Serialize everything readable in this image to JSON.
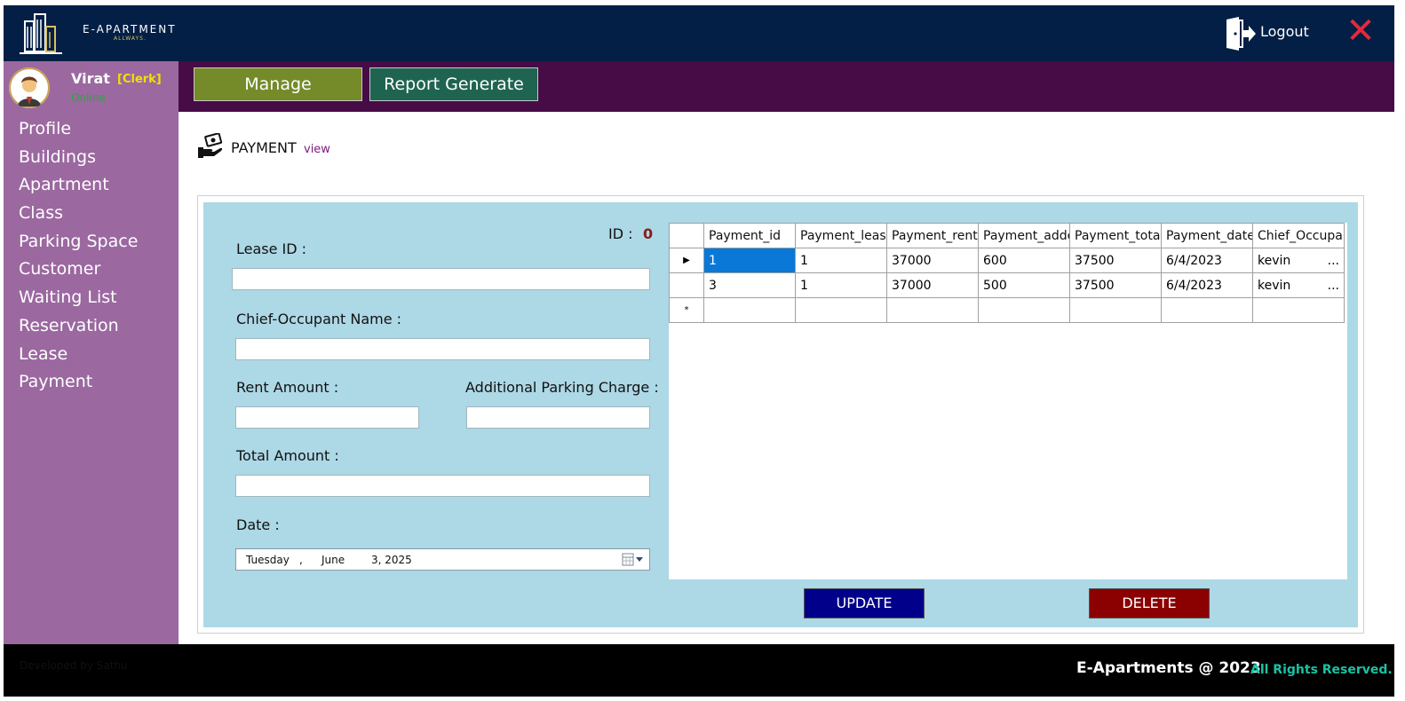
{
  "header": {
    "brand": "E-APARTMENT",
    "brand_sub": "ALLWAYS.",
    "logout_label": "Logout"
  },
  "user": {
    "name": "Virat",
    "role": "[Clerk]",
    "status": "Online"
  },
  "tabs": [
    {
      "label": "Manage",
      "color": "#758b2a"
    },
    {
      "label": "Report Generate",
      "color": "#1f6450"
    }
  ],
  "sidebar": {
    "items": [
      {
        "label": "Profile"
      },
      {
        "label": "Buildings"
      },
      {
        "label": "Apartment"
      },
      {
        "label": "Class"
      },
      {
        "label": "Parking Space"
      },
      {
        "label": "Customer"
      },
      {
        "label": "Waiting List"
      },
      {
        "label": "Reservation"
      },
      {
        "label": "Lease"
      },
      {
        "label": "Payment"
      }
    ]
  },
  "page": {
    "title": "PAYMENT",
    "subtitle": "view"
  },
  "form": {
    "id_label": "ID :",
    "id_value": "0",
    "lease_id_label": "Lease ID :",
    "lease_id_value": "",
    "chief_label": "Chief-Occupant Name :",
    "chief_value": "",
    "rent_label": "Rent Amount :",
    "rent_value": "",
    "parking_label": "Additional Parking Charge :",
    "parking_value": "",
    "total_label": "Total Amount :",
    "total_value": "",
    "date_label": "Date :",
    "date_day": "Tuesday",
    "date_sep": ",",
    "date_month": "June",
    "date_rest": "3, 2025"
  },
  "grid": {
    "columns": [
      "Payment_id",
      "Payment_lease",
      "Payment_rentA",
      "Payment_adde",
      "Payment_total",
      "Payment_date",
      "Chief_Occupar"
    ],
    "rows": [
      {
        "marker": "▶",
        "cells": [
          "1",
          "1",
          "37000",
          "600",
          "37500",
          "6/4/2023",
          "kevin"
        ],
        "selected": true
      },
      {
        "marker": "",
        "cells": [
          "3",
          "1",
          "37000",
          "500",
          "37500",
          "6/4/2023",
          "kevin"
        ],
        "selected": false
      }
    ],
    "new_row_marker": "*",
    "ellipsis": "..."
  },
  "buttons": {
    "update": "UPDATE",
    "delete": "DELETE"
  },
  "footer": {
    "developer": "Developed by Sathu",
    "copyright": "E-Apartments @ 2023",
    "rights": "All Rights Reserved."
  },
  "colors": {
    "topbar": "#031f45",
    "sidebar": "#9b68a0",
    "tabbar": "#470b46",
    "panel": "#add8e6",
    "update": "#00008b",
    "delete": "#8b0000",
    "close": "#e8283a"
  },
  "icons": {
    "logo": "building-logo-icon",
    "logout": "door-exit-icon",
    "close": "close-icon",
    "page": "payment-hand-icon",
    "calendar": "calendar-icon"
  }
}
